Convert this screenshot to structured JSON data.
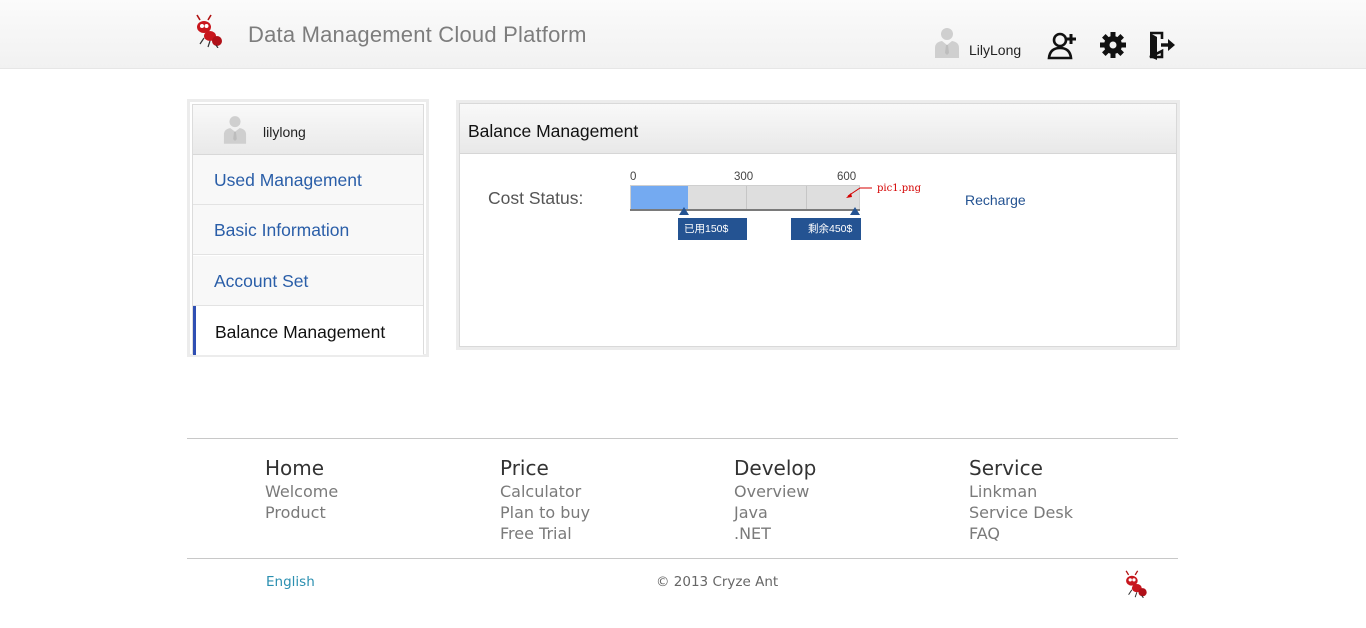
{
  "header": {
    "app_title": "Data Management Cloud Platform",
    "user_name": "LilyLong",
    "icons": [
      "ant-logo-icon",
      "user-avatar-icon",
      "add-user-icon",
      "gear-icon",
      "logout-icon"
    ]
  },
  "sidebar": {
    "user_name": "lilylong",
    "items": [
      {
        "label": "Used Management",
        "active": false
      },
      {
        "label": "Basic Information",
        "active": false
      },
      {
        "label": "Account Set",
        "active": false
      },
      {
        "label": "Balance Management",
        "active": true
      }
    ]
  },
  "panel": {
    "title": "Balance Management",
    "cost_label": "Cost Status:",
    "ticks": [
      "0",
      "300",
      "600"
    ],
    "used_value": 150,
    "max_value": 600,
    "used_badge": "已用150$",
    "remaining_badge": "剩余450$",
    "annotation": "pic1.png",
    "recharge_label": "Recharge"
  },
  "footer": {
    "columns": [
      {
        "heading": "Home",
        "links": [
          "Welcome",
          "Product"
        ]
      },
      {
        "heading": "Price",
        "links": [
          "Calculator",
          "Plan to buy",
          "Free Trial"
        ]
      },
      {
        "heading": "Develop",
        "links": [
          "Overview",
          "Java",
          ".NET"
        ]
      },
      {
        "heading": "Service",
        "links": [
          "Linkman",
          "Service Desk",
          "FAQ"
        ]
      }
    ],
    "language": "English",
    "copyright": "© 2013 Cryze Ant"
  },
  "colors": {
    "accent": "#245392",
    "link": "#2a5ea8",
    "bar_fill": "#74aaf1",
    "active_border": "#2f4fb3",
    "annotation": "#d40000"
  }
}
